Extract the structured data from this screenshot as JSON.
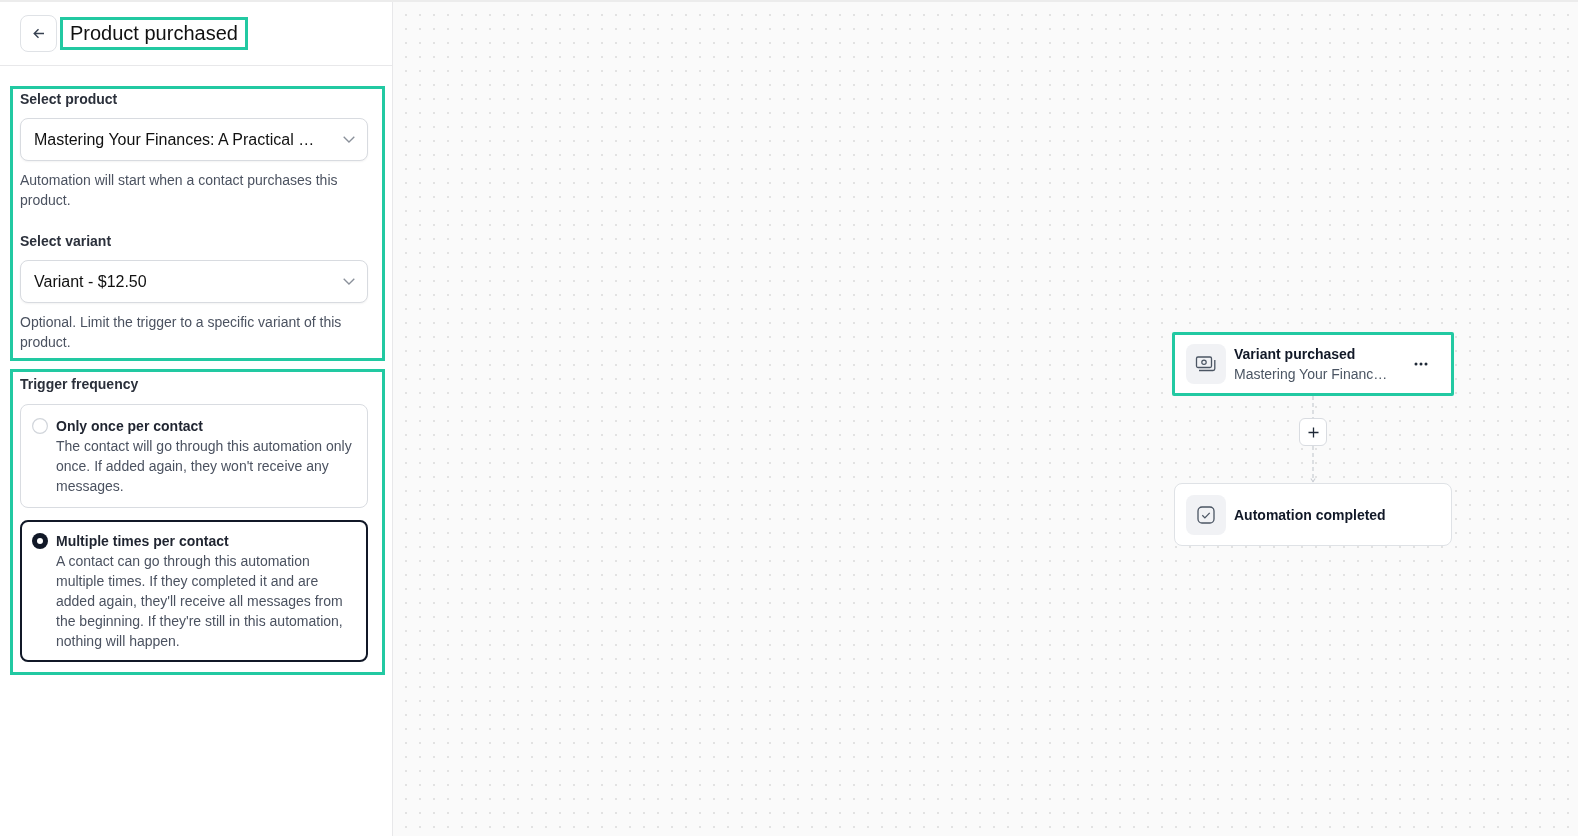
{
  "header": {
    "title": "Product purchased",
    "highlighted": true
  },
  "product_section": {
    "highlighted": true,
    "fields": [
      {
        "label": "Select product",
        "value": "Mastering Your Finances: A Practical …",
        "help": "Automation will start when a contact purchases this product."
      },
      {
        "label": "Select variant",
        "value": "Variant - $12.50",
        "help": "Optional. Limit the trigger to a specific variant of this product."
      }
    ]
  },
  "frequency_section": {
    "highlighted": true,
    "label": "Trigger frequency",
    "options": [
      {
        "title": "Only once per contact",
        "description": "The contact will go through this automation only once. If added again, they won't receive any messages.",
        "selected": false
      },
      {
        "title": "Multiple times per contact",
        "description": "A contact can go through this automation multiple times. If they completed it and are added again, they'll receive all messages from the beginning. If they're still in this automation, nothing will happen.",
        "selected": true
      }
    ]
  },
  "canvas": {
    "nodes": [
      {
        "kind": "trigger",
        "title": "Variant purchased",
        "subtitle": "Mastering Your Financ…",
        "highlighted": true
      },
      {
        "kind": "end",
        "title": "Automation completed",
        "highlighted": false
      }
    ]
  }
}
